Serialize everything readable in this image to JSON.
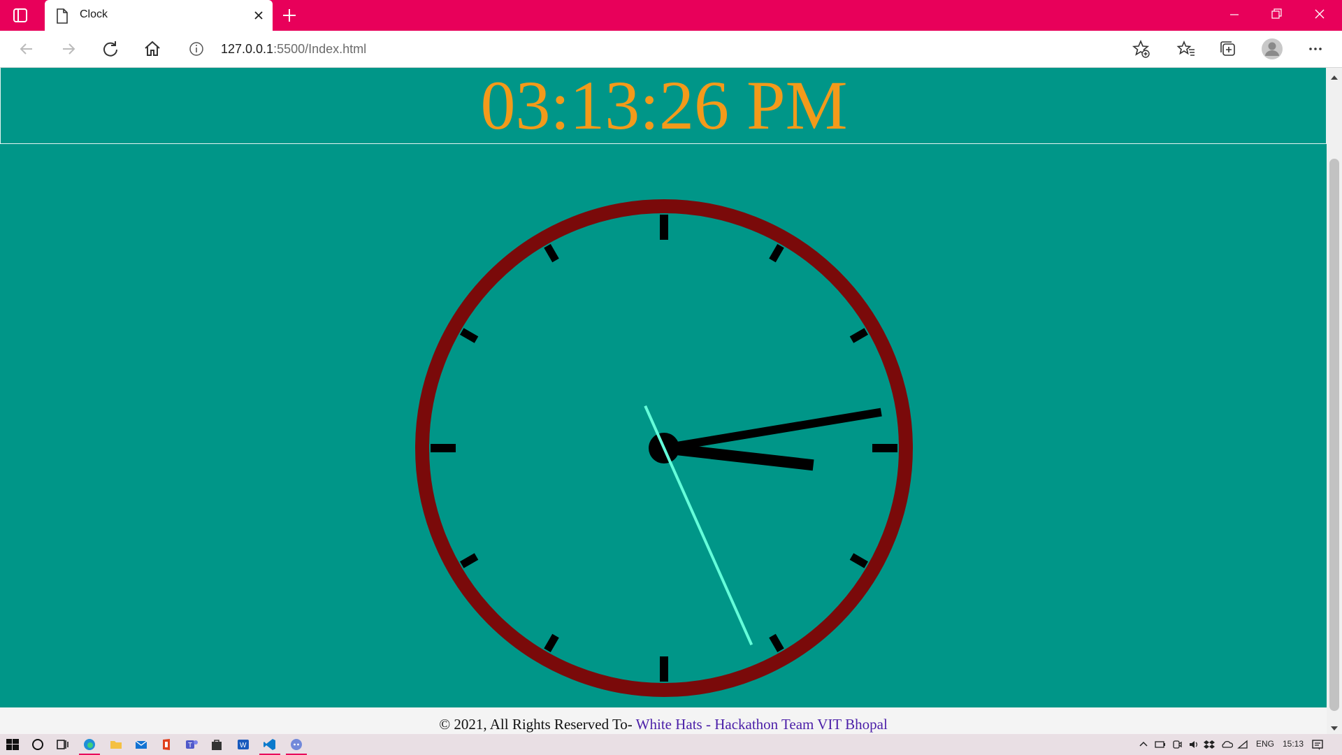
{
  "browser": {
    "tab_title": "Clock",
    "url_host": "127.0.0.1",
    "url_rest": ":5500/Index.html",
    "accent_color": "#e8005a"
  },
  "page": {
    "digital_time": "03:13:26 PM",
    "time_color": "#f39a1a",
    "background_color": "#009688",
    "clock": {
      "hour": 3,
      "minute": 13,
      "second": 26,
      "rim_color": "#7a0a0a",
      "second_hand_color": "#64ffda"
    },
    "footer": {
      "text": "© 2021, All Rights Reserved To- ",
      "link": "White Hats - Hackathon Team VIT Bhopal"
    }
  },
  "taskbar": {
    "language": "ENG",
    "clock": "15:13"
  }
}
